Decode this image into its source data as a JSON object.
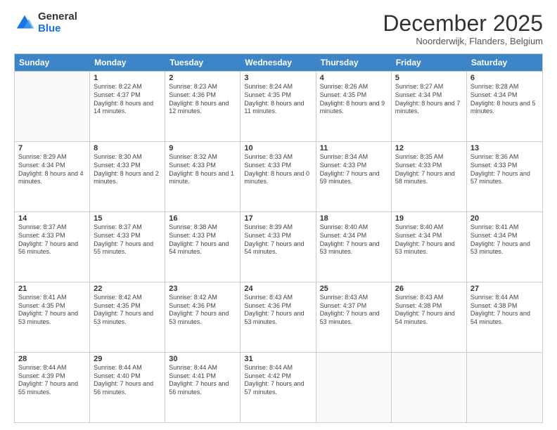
{
  "logo": {
    "general": "General",
    "blue": "Blue"
  },
  "header": {
    "title": "December 2025",
    "subtitle": "Noorderwijk, Flanders, Belgium"
  },
  "days": [
    "Sunday",
    "Monday",
    "Tuesday",
    "Wednesday",
    "Thursday",
    "Friday",
    "Saturday"
  ],
  "weeks": [
    [
      {
        "date": "",
        "empty": true
      },
      {
        "date": "1",
        "sunrise": "Sunrise: 8:22 AM",
        "sunset": "Sunset: 4:37 PM",
        "daylight": "Daylight: 8 hours and 14 minutes."
      },
      {
        "date": "2",
        "sunrise": "Sunrise: 8:23 AM",
        "sunset": "Sunset: 4:36 PM",
        "daylight": "Daylight: 8 hours and 12 minutes."
      },
      {
        "date": "3",
        "sunrise": "Sunrise: 8:24 AM",
        "sunset": "Sunset: 4:35 PM",
        "daylight": "Daylight: 8 hours and 11 minutes."
      },
      {
        "date": "4",
        "sunrise": "Sunrise: 8:26 AM",
        "sunset": "Sunset: 4:35 PM",
        "daylight": "Daylight: 8 hours and 9 minutes."
      },
      {
        "date": "5",
        "sunrise": "Sunrise: 8:27 AM",
        "sunset": "Sunset: 4:34 PM",
        "daylight": "Daylight: 8 hours and 7 minutes."
      },
      {
        "date": "6",
        "sunrise": "Sunrise: 8:28 AM",
        "sunset": "Sunset: 4:34 PM",
        "daylight": "Daylight: 8 hours and 5 minutes."
      }
    ],
    [
      {
        "date": "7",
        "sunrise": "Sunrise: 8:29 AM",
        "sunset": "Sunset: 4:34 PM",
        "daylight": "Daylight: 8 hours and 4 minutes."
      },
      {
        "date": "8",
        "sunrise": "Sunrise: 8:30 AM",
        "sunset": "Sunset: 4:33 PM",
        "daylight": "Daylight: 8 hours and 2 minutes."
      },
      {
        "date": "9",
        "sunrise": "Sunrise: 8:32 AM",
        "sunset": "Sunset: 4:33 PM",
        "daylight": "Daylight: 8 hours and 1 minute."
      },
      {
        "date": "10",
        "sunrise": "Sunrise: 8:33 AM",
        "sunset": "Sunset: 4:33 PM",
        "daylight": "Daylight: 8 hours and 0 minutes."
      },
      {
        "date": "11",
        "sunrise": "Sunrise: 8:34 AM",
        "sunset": "Sunset: 4:33 PM",
        "daylight": "Daylight: 7 hours and 59 minutes."
      },
      {
        "date": "12",
        "sunrise": "Sunrise: 8:35 AM",
        "sunset": "Sunset: 4:33 PM",
        "daylight": "Daylight: 7 hours and 58 minutes."
      },
      {
        "date": "13",
        "sunrise": "Sunrise: 8:36 AM",
        "sunset": "Sunset: 4:33 PM",
        "daylight": "Daylight: 7 hours and 57 minutes."
      }
    ],
    [
      {
        "date": "14",
        "sunrise": "Sunrise: 8:37 AM",
        "sunset": "Sunset: 4:33 PM",
        "daylight": "Daylight: 7 hours and 56 minutes."
      },
      {
        "date": "15",
        "sunrise": "Sunrise: 8:37 AM",
        "sunset": "Sunset: 4:33 PM",
        "daylight": "Daylight: 7 hours and 55 minutes."
      },
      {
        "date": "16",
        "sunrise": "Sunrise: 8:38 AM",
        "sunset": "Sunset: 4:33 PM",
        "daylight": "Daylight: 7 hours and 54 minutes."
      },
      {
        "date": "17",
        "sunrise": "Sunrise: 8:39 AM",
        "sunset": "Sunset: 4:33 PM",
        "daylight": "Daylight: 7 hours and 54 minutes."
      },
      {
        "date": "18",
        "sunrise": "Sunrise: 8:40 AM",
        "sunset": "Sunset: 4:34 PM",
        "daylight": "Daylight: 7 hours and 53 minutes."
      },
      {
        "date": "19",
        "sunrise": "Sunrise: 8:40 AM",
        "sunset": "Sunset: 4:34 PM",
        "daylight": "Daylight: 7 hours and 53 minutes."
      },
      {
        "date": "20",
        "sunrise": "Sunrise: 8:41 AM",
        "sunset": "Sunset: 4:34 PM",
        "daylight": "Daylight: 7 hours and 53 minutes."
      }
    ],
    [
      {
        "date": "21",
        "sunrise": "Sunrise: 8:41 AM",
        "sunset": "Sunset: 4:35 PM",
        "daylight": "Daylight: 7 hours and 53 minutes."
      },
      {
        "date": "22",
        "sunrise": "Sunrise: 8:42 AM",
        "sunset": "Sunset: 4:35 PM",
        "daylight": "Daylight: 7 hours and 53 minutes."
      },
      {
        "date": "23",
        "sunrise": "Sunrise: 8:42 AM",
        "sunset": "Sunset: 4:36 PM",
        "daylight": "Daylight: 7 hours and 53 minutes."
      },
      {
        "date": "24",
        "sunrise": "Sunrise: 8:43 AM",
        "sunset": "Sunset: 4:36 PM",
        "daylight": "Daylight: 7 hours and 53 minutes."
      },
      {
        "date": "25",
        "sunrise": "Sunrise: 8:43 AM",
        "sunset": "Sunset: 4:37 PM",
        "daylight": "Daylight: 7 hours and 53 minutes."
      },
      {
        "date": "26",
        "sunrise": "Sunrise: 8:43 AM",
        "sunset": "Sunset: 4:38 PM",
        "daylight": "Daylight: 7 hours and 54 minutes."
      },
      {
        "date": "27",
        "sunrise": "Sunrise: 8:44 AM",
        "sunset": "Sunset: 4:38 PM",
        "daylight": "Daylight: 7 hours and 54 minutes."
      }
    ],
    [
      {
        "date": "28",
        "sunrise": "Sunrise: 8:44 AM",
        "sunset": "Sunset: 4:39 PM",
        "daylight": "Daylight: 7 hours and 55 minutes."
      },
      {
        "date": "29",
        "sunrise": "Sunrise: 8:44 AM",
        "sunset": "Sunset: 4:40 PM",
        "daylight": "Daylight: 7 hours and 56 minutes."
      },
      {
        "date": "30",
        "sunrise": "Sunrise: 8:44 AM",
        "sunset": "Sunset: 4:41 PM",
        "daylight": "Daylight: 7 hours and 56 minutes."
      },
      {
        "date": "31",
        "sunrise": "Sunrise: 8:44 AM",
        "sunset": "Sunset: 4:42 PM",
        "daylight": "Daylight: 7 hours and 57 minutes."
      },
      {
        "date": "",
        "empty": true
      },
      {
        "date": "",
        "empty": true
      },
      {
        "date": "",
        "empty": true
      }
    ]
  ]
}
